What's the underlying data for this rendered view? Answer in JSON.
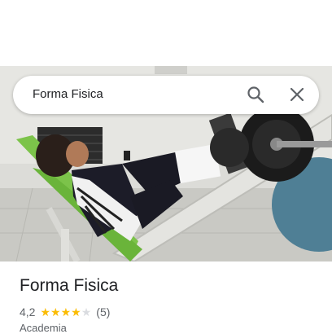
{
  "search": {
    "query": "Forma Fisica"
  },
  "place": {
    "name": "Forma Fisica",
    "rating": "4,2",
    "stars_filled": 4,
    "stars_total": 5,
    "reviews": "(5)",
    "category": "Academia"
  },
  "colors": {
    "star": "#fbbc04",
    "star_empty": "#dadce0",
    "text": "#202124",
    "muted": "#5f6368"
  },
  "icons": {
    "search": "search-icon",
    "close": "close-icon"
  }
}
